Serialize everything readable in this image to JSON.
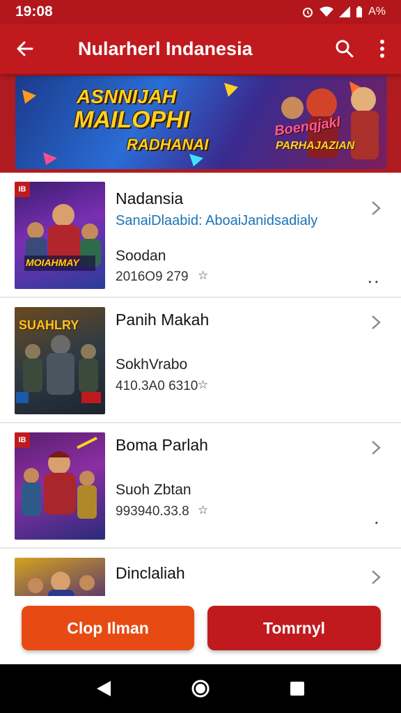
{
  "status_bar": {
    "time": "19:08",
    "battery_text": "A%"
  },
  "app_bar": {
    "title": "Nularherl Indanesia",
    "icons": [
      "back-arrow-icon",
      "search-icon",
      "more-vert-icon"
    ]
  },
  "banner": {
    "line1": "ASNNIJAH",
    "line2": "MAILOPHI",
    "line3": "RADHANAI",
    "logo1": "Boenqjakl",
    "logo2": "PARHAJAZIAN"
  },
  "items": [
    {
      "badge": "IB",
      "title": "Nadansia",
      "subtitle": "SanaiDlaabid: AboaiJanidsadialy",
      "meta": "Soodan",
      "count": "2016O9 279"
    },
    {
      "badge": "",
      "title": "Panih Makah",
      "subtitle": "",
      "meta": "SokhVrabo",
      "count": "410.3A0 6310"
    },
    {
      "badge": "IB",
      "title": "Boma Parlah",
      "subtitle": "",
      "meta": "Suoh Zbtan",
      "count": "993940.33.8"
    },
    {
      "badge": "",
      "title": "Dinclaliah",
      "subtitle": "",
      "meta": "",
      "count": ""
    }
  ],
  "thumb_texts": {
    "item1": "MOIAHMAY",
    "item2": "SUAHLRY"
  },
  "buttons": {
    "left": "Clop Ilman",
    "right": "Tomrnyl"
  },
  "colors": {
    "primary": "#c01a1f",
    "accent": "#e84a14",
    "link": "#1a73b8"
  }
}
